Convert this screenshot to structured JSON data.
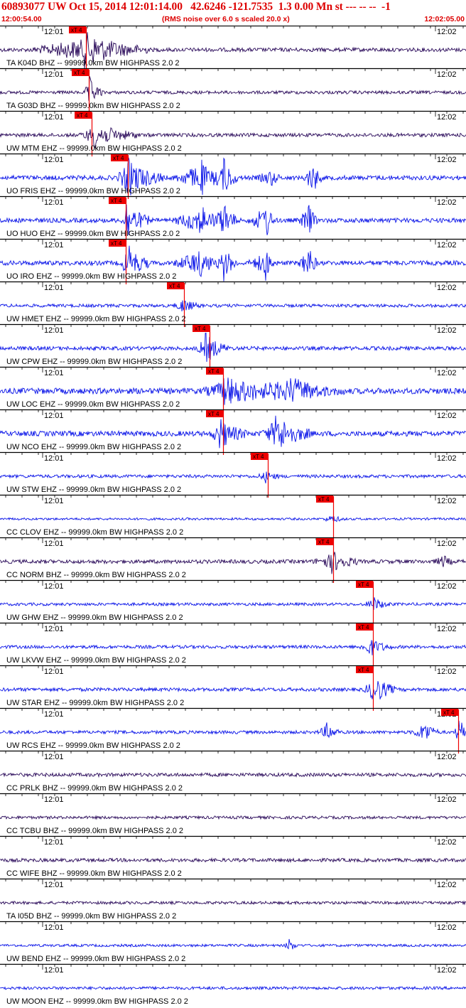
{
  "header": {
    "title": "60893077 UW Oct 15, 2014 12:01:14.00   42.6246 -121.7535  1.3 0.00 Mn st --- -- --  -1",
    "start_time": "12:00:54.00",
    "noise_note": "(RMS noise over 6.0 s scaled 20.0 x)",
    "end_time": "12:02:05.00"
  },
  "time_axis": {
    "tick_a": "12:01",
    "tick_b": "12:02"
  },
  "pick_label": "xT 4",
  "colors": {
    "pick": "#ee0000",
    "blue_trace": "#0a14e8",
    "dark_trace": "#2a0a5a",
    "text_red": "#dd0000",
    "separator": "#000000"
  },
  "traces": [
    {
      "label": "TA K04D BHZ -- 99999.0km BW  HIGHPASS  2.0  2",
      "color": "dark",
      "pick_frac": 0.185,
      "events": [
        [
          0.18,
          0.12,
          0.14,
          25
        ]
      ],
      "amp": 0.6
    },
    {
      "label": "TA G03D BHZ -- 99999.0km BW  HIGHPASS  2.0  2",
      "color": "dark",
      "pick_frac": 0.19,
      "events": [
        [
          0.19,
          0.01,
          0.03,
          24
        ]
      ],
      "amp": 0.5
    },
    {
      "label": "UW MTM EHZ -- 99999.0km BW  HIGHPASS  2.0  2",
      "color": "dark",
      "pick_frac": 0.197,
      "events": [
        [
          0.2,
          0.03,
          0.1,
          18
        ]
      ],
      "amp": 0.55
    },
    {
      "label": "UO FRIS EHZ -- 99999.0km BW  HIGHPASS  2.0  2",
      "color": "blue",
      "pick_frac": 0.275,
      "events": [
        [
          0.27,
          0.02,
          0.08,
          30
        ],
        [
          0.43,
          0.06,
          0.03,
          30
        ],
        [
          0.48,
          0.03,
          0.03,
          30
        ],
        [
          0.58,
          0.03,
          0.02,
          14
        ],
        [
          0.67,
          0.02,
          0.02,
          28
        ]
      ],
      "amp": 0.7
    },
    {
      "label": "UO HUO EHZ -- 99999.0km BW  HIGHPASS  2.0  2",
      "color": "blue",
      "pick_frac": 0.27,
      "events": [
        [
          0.27,
          0.01,
          0.05,
          30
        ],
        [
          0.43,
          0.06,
          0.03,
          30
        ],
        [
          0.48,
          0.03,
          0.03,
          30
        ],
        [
          0.57,
          0.04,
          0.02,
          30
        ],
        [
          0.66,
          0.02,
          0.02,
          30
        ]
      ],
      "amp": 0.7
    },
    {
      "label": "UO IRO EHZ -- 99999.0km BW  HIGHPASS  2.0  2",
      "color": "blue",
      "pick_frac": 0.27,
      "events": [
        [
          0.27,
          0.01,
          0.05,
          30
        ],
        [
          0.43,
          0.06,
          0.03,
          30
        ],
        [
          0.48,
          0.02,
          0.03,
          24
        ],
        [
          0.57,
          0.04,
          0.02,
          24
        ],
        [
          0.66,
          0.02,
          0.02,
          30
        ]
      ],
      "amp": 0.7
    },
    {
      "label": "UW HMET EHZ -- 99999.0km BW  HIGHPASS  2.0  2",
      "color": "blue",
      "pick_frac": 0.395,
      "events": [
        [
          0.39,
          0.02,
          0.04,
          10
        ]
      ],
      "amp": 0.5
    },
    {
      "label": "UW CPW EHZ -- 99999.0km BW  HIGHPASS  2.0  2",
      "color": "blue",
      "pick_frac": 0.45,
      "events": [
        [
          0.44,
          0.02,
          0.05,
          22
        ]
      ],
      "amp": 0.6
    },
    {
      "label": "UW LOC EHZ -- 99999.0km BW  HIGHPASS  2.0  2",
      "color": "blue",
      "pick_frac": 0.478,
      "events": [
        [
          0.48,
          0.05,
          0.2,
          18
        ],
        [
          0.62,
          0.06,
          0.12,
          14
        ]
      ],
      "amp": 0.9
    },
    {
      "label": "UW NCO EHZ -- 99999.0km BW  HIGHPASS  2.0  2",
      "color": "blue",
      "pick_frac": 0.478,
      "events": [
        [
          0.47,
          0.02,
          0.06,
          22
        ],
        [
          0.59,
          0.03,
          0.08,
          28
        ]
      ],
      "amp": 0.8
    },
    {
      "label": "UW STW EHZ -- 99999.0km BW  HIGHPASS  2.0  2",
      "color": "blue",
      "pick_frac": 0.575,
      "events": [
        [
          0.57,
          0.02,
          0.03,
          8
        ]
      ],
      "amp": 0.5
    },
    {
      "label": "CC CLOV EHZ -- 99999.0km BW  HIGHPASS  2.0  2",
      "color": "blue",
      "pick_frac": 0.715,
      "events": [
        [
          0.71,
          0.02,
          0.03,
          6
        ]
      ],
      "amp": 0.35
    },
    {
      "label": "CC NORM BHZ -- 99999.0km BW  HIGHPASS  2.0  2",
      "color": "dark",
      "pick_frac": 0.715,
      "events": [
        [
          0.71,
          0.04,
          0.06,
          16
        ],
        [
          0.95,
          0.02,
          0.02,
          10
        ]
      ],
      "amp": 0.6
    },
    {
      "label": "UW GHW EHZ -- 99999.0km BW  HIGHPASS  2.0  2",
      "color": "blue",
      "pick_frac": 0.8,
      "events": [
        [
          0.8,
          0.02,
          0.04,
          10
        ]
      ],
      "amp": 0.45
    },
    {
      "label": "UW LKVW EHZ -- 99999.0km BW  HIGHPASS  2.0  2",
      "color": "blue",
      "pick_frac": 0.8,
      "events": [
        [
          0.79,
          0.02,
          0.05,
          14
        ]
      ],
      "amp": 0.5
    },
    {
      "label": "UW STAR EHZ -- 99999.0km BW  HIGHPASS  2.0  2",
      "color": "blue",
      "pick_frac": 0.8,
      "events": [
        [
          0.8,
          0.02,
          0.05,
          24
        ]
      ],
      "amp": 0.55
    },
    {
      "label": "UW RCS EHZ -- 99999.0km BW  HIGHPASS  2.0  2",
      "color": "blue",
      "pick_frac": 0.983,
      "events": [
        [
          0.7,
          0.02,
          0.03,
          14
        ],
        [
          0.91,
          0.03,
          0.03,
          18
        ],
        [
          0.985,
          0.01,
          0.015,
          30
        ]
      ],
      "amp": 0.5
    },
    {
      "label": "CC PRLK BHZ -- 99999.0km BW  HIGHPASS  2.0  2",
      "color": "dark",
      "pick_frac": null,
      "events": [],
      "amp": 0.55
    },
    {
      "label": "CC TCBU BHZ -- 99999.0km BW  HIGHPASS  2.0  2",
      "color": "dark",
      "pick_frac": null,
      "events": [],
      "amp": 0.45
    },
    {
      "label": "CC WIFE BHZ -- 99999.0km BW  HIGHPASS  2.0  2",
      "color": "dark",
      "pick_frac": null,
      "events": [],
      "amp": 0.55
    },
    {
      "label": "TA I05D BHZ -- 99999.0km BW  HIGHPASS  2.0  2",
      "color": "dark",
      "pick_frac": null,
      "events": [],
      "amp": 0.45
    },
    {
      "label": "UW BEND EHZ -- 99999.0km BW  HIGHPASS  2.0  2",
      "color": "blue",
      "pick_frac": null,
      "events": [
        [
          0.62,
          0.01,
          0.02,
          10
        ]
      ],
      "amp": 0.4
    },
    {
      "label": "UW MOON EHZ -- 99999.0km BW  HIGHPASS  2.0  2",
      "color": "blue",
      "pick_frac": null,
      "events": [],
      "amp": 0.45
    }
  ]
}
